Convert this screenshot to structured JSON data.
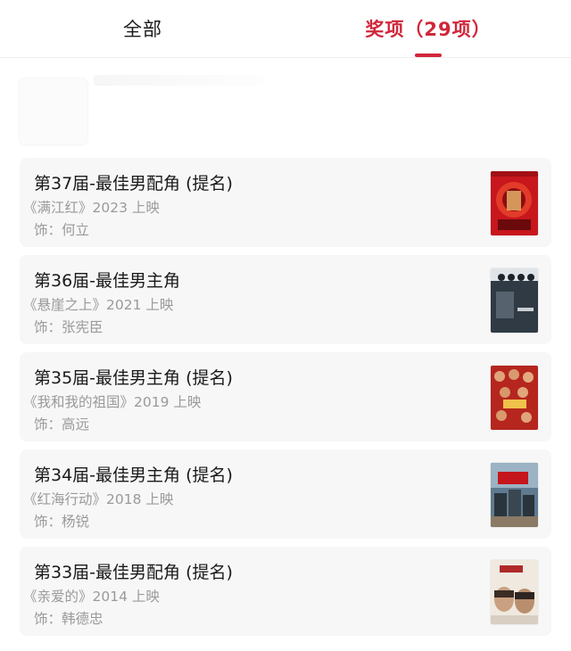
{
  "tabs": {
    "all_label": "全部",
    "awards_label": "奖项（29项）"
  },
  "awards": [
    {
      "title": "第37届-最佳男配角 (提名)",
      "movie": "《满江红》2023 上映",
      "role": "饰：何立",
      "poster_icon": "poster-manjianghong-icon"
    },
    {
      "title": "第36届-最佳男主角",
      "movie": "《悬崖之上》2021 上映",
      "role": "饰：张宪臣",
      "poster_icon": "poster-xuanyazhishang-icon"
    },
    {
      "title": "第35届-最佳男主角 (提名)",
      "movie": "《我和我的祖国》2019 上映",
      "role": "饰：高远",
      "poster_icon": "poster-wohewodezuguo-icon"
    },
    {
      "title": "第34届-最佳男主角 (提名)",
      "movie": "《红海行动》2018 上映",
      "role": "饰：杨锐",
      "poster_icon": "poster-honghaixingdong-icon"
    },
    {
      "title": "第33届-最佳男配角 (提名)",
      "movie": "《亲爱的》2014 上映",
      "role": "饰：韩德忠",
      "poster_icon": "poster-qinaide-icon"
    }
  ],
  "colors": {
    "accent": "#d1273b",
    "card_bg": "#f7f7f7",
    "secondary_text": "#9a9a9a"
  }
}
